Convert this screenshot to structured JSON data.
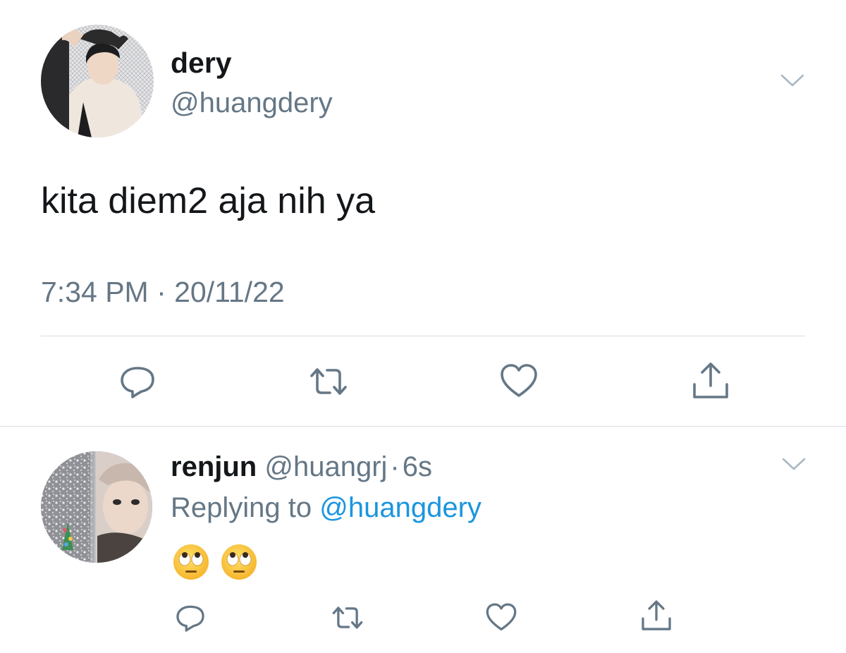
{
  "main_tweet": {
    "display_name": "dery",
    "handle": "@huangdery",
    "text": "kita diem2 aja nih ya",
    "timestamp": "7:34 PM · 20/11/22",
    "actions": [
      "reply-icon",
      "retweet-icon",
      "like-icon",
      "share-icon"
    ]
  },
  "reply": {
    "display_name": "renjun",
    "handle": "@huangrj",
    "separator": "·",
    "age": "6s",
    "replying_prefix": "Replying to",
    "replying_to": "@huangdery",
    "emojis": [
      "face-with-rolling-eyes-emoji",
      "face-with-rolling-eyes-emoji"
    ],
    "actions": [
      "reply-icon",
      "retweet-icon",
      "like-icon",
      "share-icon"
    ]
  },
  "colors": {
    "text": "#14171a",
    "secondary": "#657786",
    "link": "#1b95e0",
    "divider": "#d9dde1",
    "icon": "#657786"
  }
}
